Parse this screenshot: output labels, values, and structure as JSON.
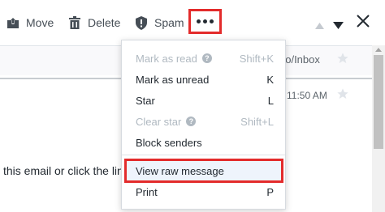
{
  "toolbar": {
    "move_label": "Move",
    "delete_label": "Delete",
    "spam_label": "Spam",
    "icons": {
      "move": "move-icon",
      "delete": "trash-icon",
      "spam": "shield-icon",
      "more": "more-dots-icon",
      "prev": "chevron-up-icon",
      "next": "chevron-down-icon",
      "close": "close-icon"
    }
  },
  "message": {
    "folder": "oo/Inbox",
    "time": "11:50 AM",
    "body_snippet": "this email or click the lin"
  },
  "menu": {
    "items": [
      {
        "label": "Mark as read",
        "shortcut": "Shift+K",
        "disabled": true,
        "help": true
      },
      {
        "label": "Mark as unread",
        "shortcut": "K",
        "disabled": false
      },
      {
        "label": "Star",
        "shortcut": "L",
        "disabled": false
      },
      {
        "label": "Clear star",
        "shortcut": "Shift+L",
        "disabled": true,
        "help": true
      },
      {
        "label": "Block senders",
        "shortcut": "",
        "disabled": false
      },
      {
        "label": "View raw message",
        "shortcut": "",
        "disabled": false,
        "highlighted": true
      },
      {
        "label": "Print",
        "shortcut": "P",
        "disabled": false
      }
    ],
    "help_glyph": "?"
  },
  "colors": {
    "highlight_border": "#e32b2b",
    "disabled_text": "#b0b9c1",
    "text": "#232a31"
  }
}
